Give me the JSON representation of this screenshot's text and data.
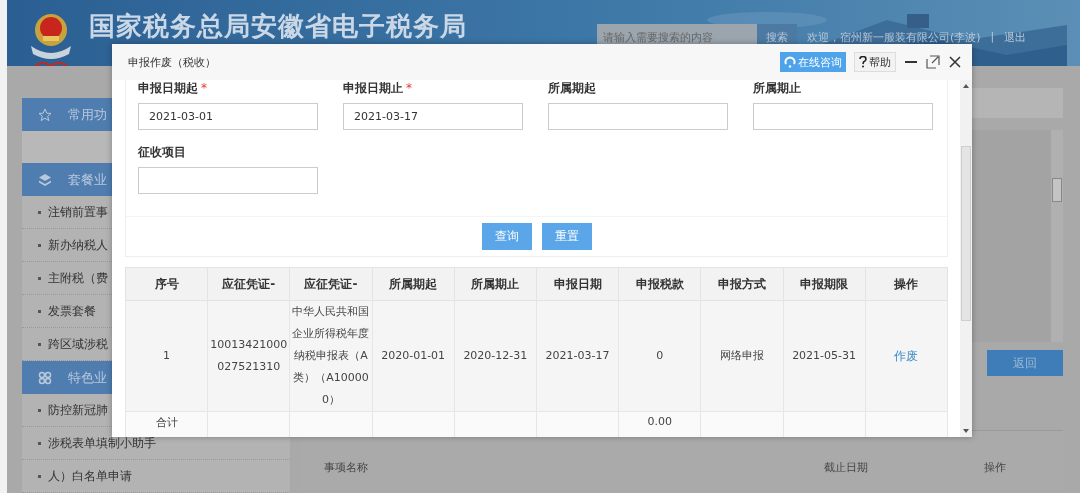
{
  "header": {
    "title": "国家税务总局安徽省电子税务局",
    "search": {
      "placeholder": "请输入需要搜索的内容"
    },
    "search_button": "搜索",
    "welcome": "欢迎，宿州新一服装有限公司(李波)",
    "separator": "|",
    "logout": "退出"
  },
  "sidebar": [
    {
      "kind": "section",
      "label": "常用功"
    },
    {
      "kind": "spacer"
    },
    {
      "kind": "section",
      "label": "套餐业"
    },
    {
      "kind": "item",
      "label": "注销前置事"
    },
    {
      "kind": "item",
      "label": "新办纳税人"
    },
    {
      "kind": "item",
      "label": "主附税（费"
    },
    {
      "kind": "item",
      "label": "发票套餐"
    },
    {
      "kind": "item",
      "label": "跨区域涉税"
    },
    {
      "kind": "section",
      "label": "特色业"
    },
    {
      "kind": "item",
      "label": "防控新冠肺"
    },
    {
      "kind": "item",
      "label": "涉税表单填制小助手"
    },
    {
      "kind": "item",
      "label": "人）白名单申请"
    }
  ],
  "main": {
    "back_button": "返回",
    "columns": [
      "事项名称",
      "截止日期",
      "操作"
    ]
  },
  "dialog": {
    "title": "申报作废（税收）",
    "consult_button": "在线咨询",
    "help_button": "帮助",
    "fields": [
      {
        "label": "申报日期起",
        "required_mark": "*",
        "value": "2021-03-01"
      },
      {
        "label": "申报日期止",
        "required_mark": "*",
        "value": "2021-03-17"
      },
      {
        "label": "所属期起"
      },
      {
        "label": "所属期止"
      },
      {
        "label": "征收项目"
      }
    ],
    "query_button": "查询",
    "reset_button": "重置",
    "table": {
      "columns": [
        "序号",
        "应征凭证-",
        "应征凭证-",
        "所属期起",
        "所属期止",
        "申报日期",
        "申报税款",
        "申报方式",
        "申报期限",
        "操作"
      ],
      "rows": [
        {
          "index": "1",
          "voucher_no": "10013421000027521310",
          "voucher_name": "中华人民共和国企业所得税年度纳税申报表（A类）（A100000）",
          "period_start": "2020-01-01",
          "period_end": "2020-12-31",
          "filing_date": "2021-03-17",
          "tax": "0",
          "method": "网络申报",
          "deadline": "2021-05-31",
          "action": "作废"
        }
      ],
      "total": {
        "label": "合计",
        "tax": "0.00"
      }
    }
  }
}
